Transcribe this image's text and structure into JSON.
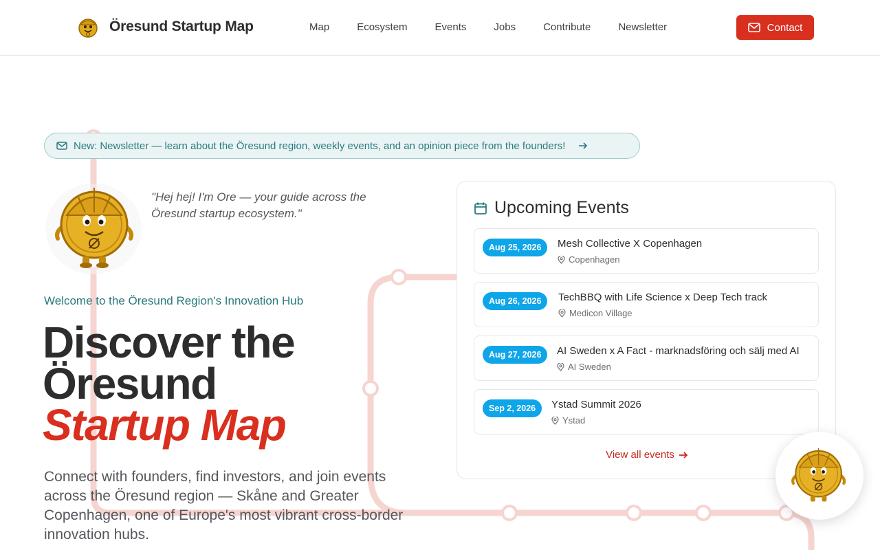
{
  "header": {
    "brand": "Öresund Startup Map",
    "nav": [
      "Map",
      "Ecosystem",
      "Events",
      "Jobs",
      "Contribute",
      "Newsletter"
    ],
    "contact_label": "Contact"
  },
  "banner": {
    "text": "New: Newsletter — learn about the Öresund region, weekly events, and an opinion piece from the founders!"
  },
  "hero": {
    "quote": "\"Hej hej! I'm Ore — your guide across the Öresund startup ecosystem.\"",
    "eyebrow": "Welcome to the Öresund Region's Innovation Hub",
    "headline_line1": "Discover the",
    "headline_line2": "Öresund",
    "headline_accent": "Startup Map",
    "lead": "Connect with founders, find investors, and join events across the Öresund region — Skåne and Greater Copenhagen, one of Europe's most vibrant cross-border innovation hubs."
  },
  "events": {
    "title": "Upcoming Events",
    "items": [
      {
        "date": "Aug 25, 2026",
        "title": "Mesh Collective X Copenhagen",
        "location": "Copenhagen"
      },
      {
        "date": "Aug 26, 2026",
        "title": "TechBBQ with Life Science x Deep Tech track",
        "location": "Medicon Village"
      },
      {
        "date": "Aug 27, 2026",
        "title": "AI Sweden x A Fact - marknadsföring och sälj med AI",
        "location": "AI Sweden"
      },
      {
        "date": "Sep 2, 2026",
        "title": "Ystad Summit 2026",
        "location": "Ystad"
      }
    ],
    "view_all": "View all events"
  },
  "colors": {
    "accent_red": "#d92f1f",
    "teal": "#2a7a7e",
    "date_badge": "#0ea5e9"
  },
  "icons": [
    "mail-icon",
    "arrow-right-icon",
    "calendar-icon",
    "map-pin-icon",
    "mascot-coin"
  ]
}
